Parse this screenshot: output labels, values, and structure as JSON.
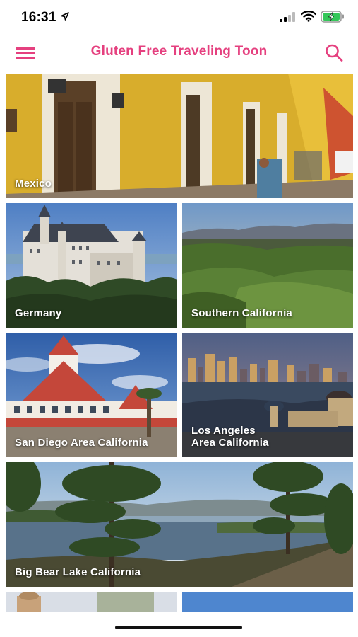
{
  "status_bar": {
    "time": "16:31"
  },
  "header": {
    "title": "Gluten Free Traveling Toon"
  },
  "icons": {
    "menu": "hamburger-menu-icon",
    "search": "search-icon",
    "location": "location-arrow-icon",
    "signal": "cellular-signal-icon",
    "wifi": "wifi-icon",
    "battery": "battery-charging-icon"
  },
  "colors": {
    "accent": "#e5407f",
    "battery": "#34c759"
  },
  "destinations": [
    {
      "label": "Mexico"
    },
    {
      "label": "Germany"
    },
    {
      "label": "Southern California"
    },
    {
      "label": "San Diego Area California"
    },
    {
      "label": "Los Angeles\nArea California"
    },
    {
      "label": "Big Bear Lake California"
    }
  ]
}
